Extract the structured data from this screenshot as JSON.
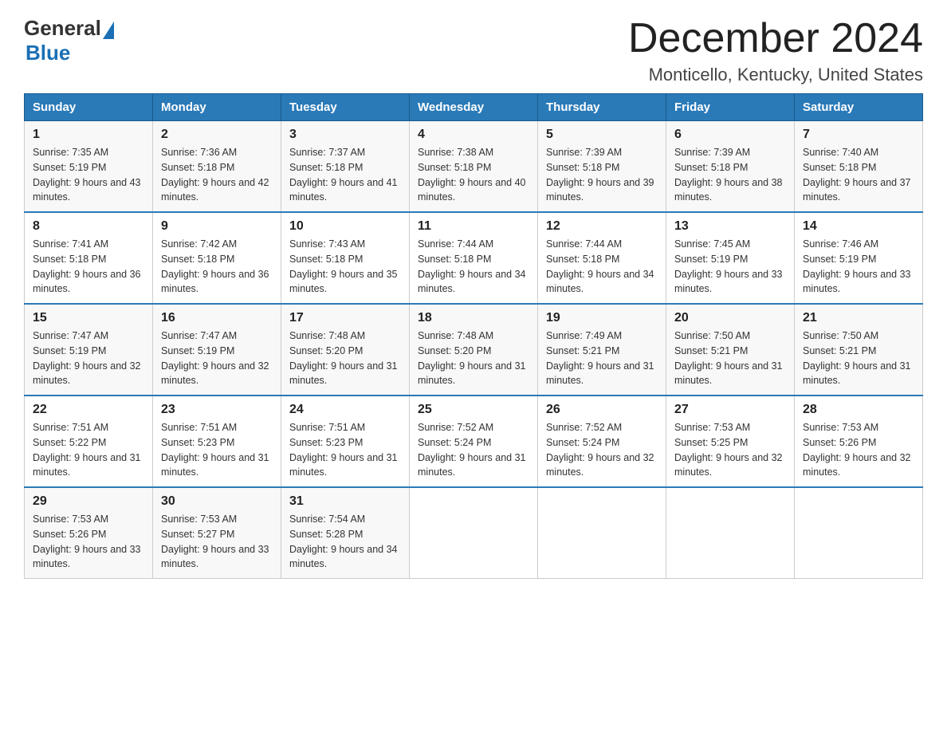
{
  "header": {
    "logo_general": "General",
    "logo_blue": "Blue",
    "main_title": "December 2024",
    "subtitle": "Monticello, Kentucky, United States"
  },
  "weekdays": [
    "Sunday",
    "Monday",
    "Tuesday",
    "Wednesday",
    "Thursday",
    "Friday",
    "Saturday"
  ],
  "weeks": [
    [
      {
        "day": "1",
        "sunrise": "7:35 AM",
        "sunset": "5:19 PM",
        "daylight": "9 hours and 43 minutes."
      },
      {
        "day": "2",
        "sunrise": "7:36 AM",
        "sunset": "5:18 PM",
        "daylight": "9 hours and 42 minutes."
      },
      {
        "day": "3",
        "sunrise": "7:37 AM",
        "sunset": "5:18 PM",
        "daylight": "9 hours and 41 minutes."
      },
      {
        "day": "4",
        "sunrise": "7:38 AM",
        "sunset": "5:18 PM",
        "daylight": "9 hours and 40 minutes."
      },
      {
        "day": "5",
        "sunrise": "7:39 AM",
        "sunset": "5:18 PM",
        "daylight": "9 hours and 39 minutes."
      },
      {
        "day": "6",
        "sunrise": "7:39 AM",
        "sunset": "5:18 PM",
        "daylight": "9 hours and 38 minutes."
      },
      {
        "day": "7",
        "sunrise": "7:40 AM",
        "sunset": "5:18 PM",
        "daylight": "9 hours and 37 minutes."
      }
    ],
    [
      {
        "day": "8",
        "sunrise": "7:41 AM",
        "sunset": "5:18 PM",
        "daylight": "9 hours and 36 minutes."
      },
      {
        "day": "9",
        "sunrise": "7:42 AM",
        "sunset": "5:18 PM",
        "daylight": "9 hours and 36 minutes."
      },
      {
        "day": "10",
        "sunrise": "7:43 AM",
        "sunset": "5:18 PM",
        "daylight": "9 hours and 35 minutes."
      },
      {
        "day": "11",
        "sunrise": "7:44 AM",
        "sunset": "5:18 PM",
        "daylight": "9 hours and 34 minutes."
      },
      {
        "day": "12",
        "sunrise": "7:44 AM",
        "sunset": "5:18 PM",
        "daylight": "9 hours and 34 minutes."
      },
      {
        "day": "13",
        "sunrise": "7:45 AM",
        "sunset": "5:19 PM",
        "daylight": "9 hours and 33 minutes."
      },
      {
        "day": "14",
        "sunrise": "7:46 AM",
        "sunset": "5:19 PM",
        "daylight": "9 hours and 33 minutes."
      }
    ],
    [
      {
        "day": "15",
        "sunrise": "7:47 AM",
        "sunset": "5:19 PM",
        "daylight": "9 hours and 32 minutes."
      },
      {
        "day": "16",
        "sunrise": "7:47 AM",
        "sunset": "5:19 PM",
        "daylight": "9 hours and 32 minutes."
      },
      {
        "day": "17",
        "sunrise": "7:48 AM",
        "sunset": "5:20 PM",
        "daylight": "9 hours and 31 minutes."
      },
      {
        "day": "18",
        "sunrise": "7:48 AM",
        "sunset": "5:20 PM",
        "daylight": "9 hours and 31 minutes."
      },
      {
        "day": "19",
        "sunrise": "7:49 AM",
        "sunset": "5:21 PM",
        "daylight": "9 hours and 31 minutes."
      },
      {
        "day": "20",
        "sunrise": "7:50 AM",
        "sunset": "5:21 PM",
        "daylight": "9 hours and 31 minutes."
      },
      {
        "day": "21",
        "sunrise": "7:50 AM",
        "sunset": "5:21 PM",
        "daylight": "9 hours and 31 minutes."
      }
    ],
    [
      {
        "day": "22",
        "sunrise": "7:51 AM",
        "sunset": "5:22 PM",
        "daylight": "9 hours and 31 minutes."
      },
      {
        "day": "23",
        "sunrise": "7:51 AM",
        "sunset": "5:23 PM",
        "daylight": "9 hours and 31 minutes."
      },
      {
        "day": "24",
        "sunrise": "7:51 AM",
        "sunset": "5:23 PM",
        "daylight": "9 hours and 31 minutes."
      },
      {
        "day": "25",
        "sunrise": "7:52 AM",
        "sunset": "5:24 PM",
        "daylight": "9 hours and 31 minutes."
      },
      {
        "day": "26",
        "sunrise": "7:52 AM",
        "sunset": "5:24 PM",
        "daylight": "9 hours and 32 minutes."
      },
      {
        "day": "27",
        "sunrise": "7:53 AM",
        "sunset": "5:25 PM",
        "daylight": "9 hours and 32 minutes."
      },
      {
        "day": "28",
        "sunrise": "7:53 AM",
        "sunset": "5:26 PM",
        "daylight": "9 hours and 32 minutes."
      }
    ],
    [
      {
        "day": "29",
        "sunrise": "7:53 AM",
        "sunset": "5:26 PM",
        "daylight": "9 hours and 33 minutes."
      },
      {
        "day": "30",
        "sunrise": "7:53 AM",
        "sunset": "5:27 PM",
        "daylight": "9 hours and 33 minutes."
      },
      {
        "day": "31",
        "sunrise": "7:54 AM",
        "sunset": "5:28 PM",
        "daylight": "9 hours and 34 minutes."
      },
      null,
      null,
      null,
      null
    ]
  ]
}
